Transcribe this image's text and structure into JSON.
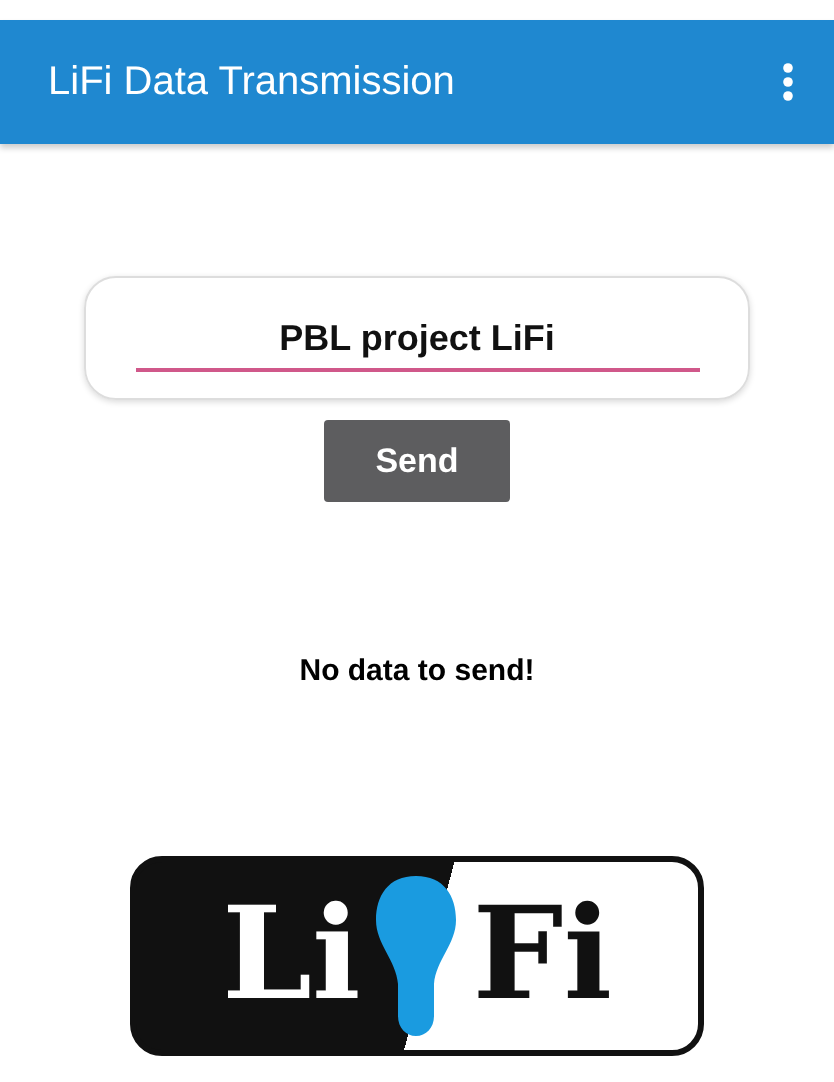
{
  "app_bar": {
    "title": "LiFi Data Transmission"
  },
  "message_field": {
    "value": "PBL project LiFi"
  },
  "send_button": {
    "label": "Send"
  },
  "status": "No data to send!",
  "logo": {
    "left_text": "Li",
    "right_text": "Fi"
  }
}
